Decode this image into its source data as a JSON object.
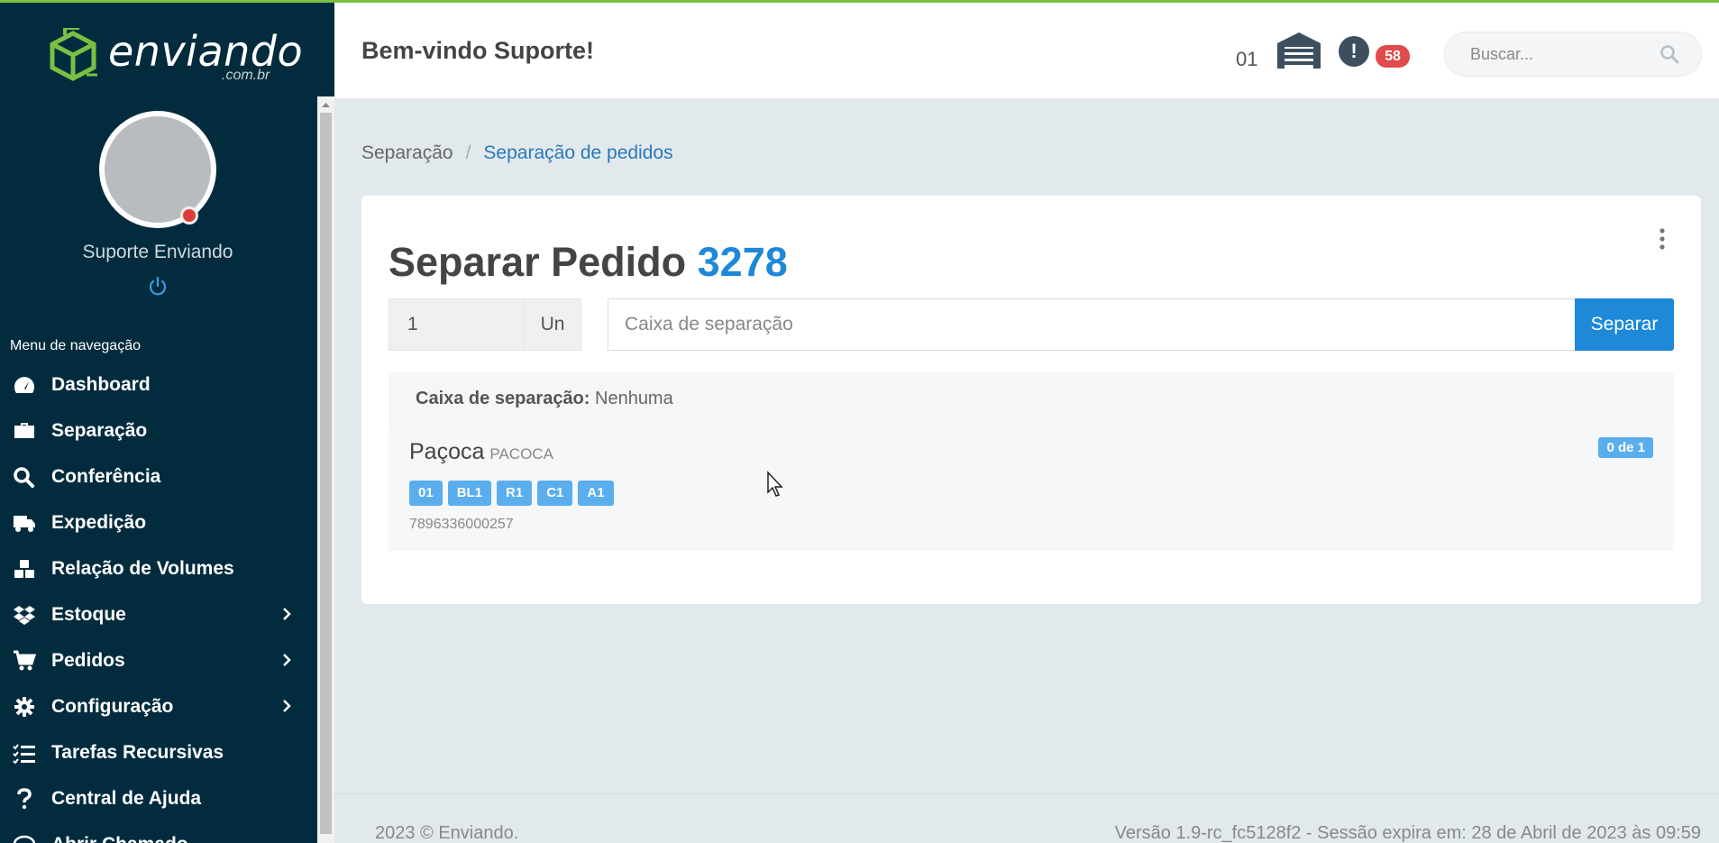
{
  "brand": {
    "name": "enviando",
    "suffix": ".com.br",
    "logo_icon": "box-arrow-logo-icon",
    "accent": "#7ac143"
  },
  "user": {
    "name": "Suporte Enviando",
    "status_color": "#e03b3b"
  },
  "sidebar": {
    "bg": "#022c3e",
    "title": "Menu de navegação",
    "items": [
      {
        "label": "Dashboard",
        "icon": "speedometer-icon"
      },
      {
        "label": "Separação",
        "icon": "briefcase-icon"
      },
      {
        "label": "Conferência",
        "icon": "search-icon"
      },
      {
        "label": "Expedição",
        "icon": "truck-icon"
      },
      {
        "label": "Relação de Volumes",
        "icon": "boxes-icon"
      },
      {
        "label": "Estoque",
        "icon": "dropbox-icon",
        "expandable": true
      },
      {
        "label": "Pedidos",
        "icon": "cart-icon",
        "expandable": true
      },
      {
        "label": "Configuração",
        "icon": "gear-icon",
        "expandable": true
      },
      {
        "label": "Tarefas Recursivas",
        "icon": "checklist-icon"
      },
      {
        "label": "Central de Ajuda",
        "icon": "question-icon"
      },
      {
        "label": "Abrir Chamado",
        "icon": "chat-icon"
      }
    ]
  },
  "header": {
    "welcome": "Bem-vindo Suporte!",
    "warehouse_number": "01",
    "alerts_count": "58",
    "search_placeholder": "Buscar..."
  },
  "breadcrumb": {
    "parent": "Separação",
    "separator": "/",
    "current": "Separação de pedidos"
  },
  "card": {
    "title_prefix": "Separar Pedido",
    "order_number": "3278",
    "quantity": "1",
    "unit": "Un",
    "box_placeholder": "Caixa de separação",
    "submit_label": "Separar",
    "box_label": "Caixa de separação:",
    "box_value": "Nenhuma",
    "item": {
      "name": "Paçoca",
      "code": "PACOCA",
      "progress": "0 de 1",
      "locations": [
        "01",
        "BL1",
        "R1",
        "C1",
        "A1"
      ],
      "barcode": "7896336000257"
    },
    "primary_color": "#1e88d9",
    "tag_color": "#5aaeed"
  },
  "footer": {
    "copyright": "2023 © Enviando.",
    "version": "Versão 1.9-rc_fc5128f2 - Sessão expira em: 28 de Abril de 2023 às 09:59"
  }
}
